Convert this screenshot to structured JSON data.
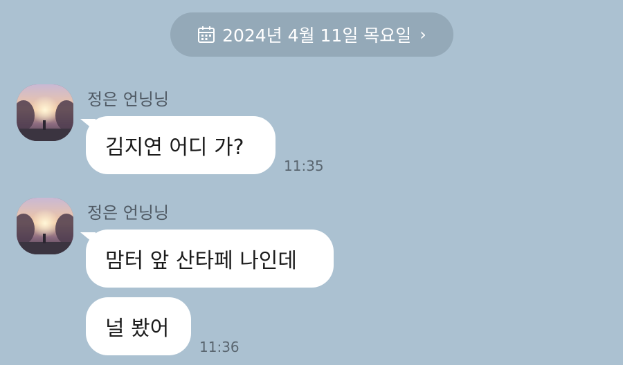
{
  "date_divider": {
    "text": "2024년 4월 11일 목요일",
    "icon": "calendar-icon",
    "chevron": "›"
  },
  "messages": [
    {
      "sender": "정은 언닝닝",
      "text": "김지연 어디 가?",
      "time": "11:35"
    },
    {
      "sender": "정은 언닝닝",
      "text": "맘터 앞 산타페 나인데",
      "time": ""
    },
    {
      "sender": "",
      "text": "널 봤어",
      "time": "11:36"
    }
  ],
  "colors": {
    "background": "#abc1d1",
    "bubble": "#ffffff",
    "date_pill": "#94a9b8"
  }
}
